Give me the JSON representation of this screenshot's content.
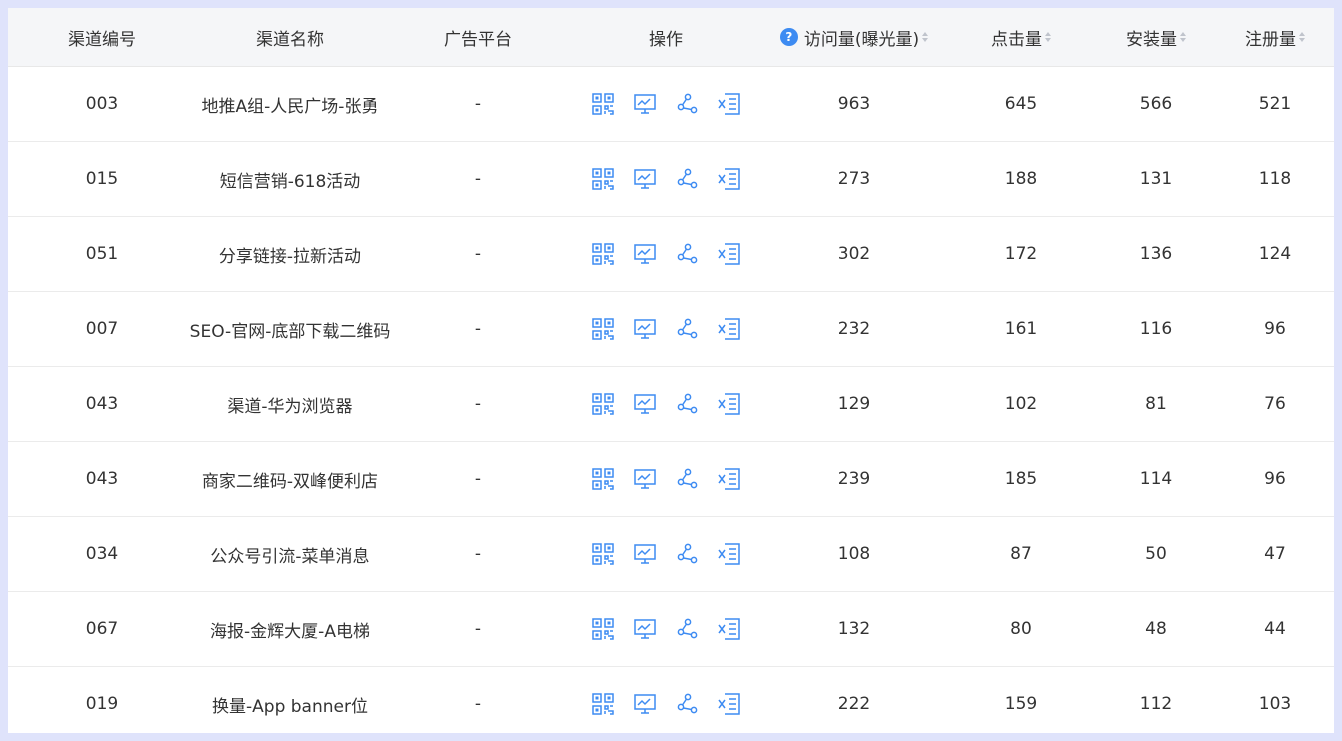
{
  "table": {
    "headers": {
      "id": "渠道编号",
      "name": "渠道名称",
      "platform": "广告平台",
      "ops": "操作",
      "visits": "访问量(曝光量)",
      "clicks": "点击量",
      "installs": "安装量",
      "registrations": "注册量"
    },
    "operations_icons": [
      "qrcode-icon",
      "chart-icon",
      "share-icon",
      "excel-icon"
    ],
    "rows": [
      {
        "id": "003",
        "name": "地推A组-人民广场-张勇",
        "platform": "-",
        "visits": "963",
        "clicks": "645",
        "installs": "566",
        "registrations": "521"
      },
      {
        "id": "015",
        "name": "短信营销-618活动",
        "platform": "-",
        "visits": "273",
        "clicks": "188",
        "installs": "131",
        "registrations": "118"
      },
      {
        "id": "051",
        "name": "分享链接-拉新活动",
        "platform": "-",
        "visits": "302",
        "clicks": "172",
        "installs": "136",
        "registrations": "124"
      },
      {
        "id": "007",
        "name": "SEO-官网-底部下载二维码",
        "platform": "-",
        "visits": "232",
        "clicks": "161",
        "installs": "116",
        "registrations": "96"
      },
      {
        "id": "043",
        "name": "渠道-华为浏览器",
        "platform": "-",
        "visits": "129",
        "clicks": "102",
        "installs": "81",
        "registrations": "76"
      },
      {
        "id": "043",
        "name": "商家二维码-双峰便利店",
        "platform": "-",
        "visits": "239",
        "clicks": "185",
        "installs": "114",
        "registrations": "96"
      },
      {
        "id": "034",
        "name": "公众号引流-菜单消息",
        "platform": "-",
        "visits": "108",
        "clicks": "87",
        "installs": "50",
        "registrations": "47"
      },
      {
        "id": "067",
        "name": "海报-金辉大厦-A电梯",
        "platform": "-",
        "visits": "132",
        "clicks": "80",
        "installs": "48",
        "registrations": "44"
      },
      {
        "id": "019",
        "name": "换量-App banner位",
        "platform": "-",
        "visits": "222",
        "clicks": "159",
        "installs": "112",
        "registrations": "103"
      }
    ]
  },
  "colors": {
    "accent": "#3d8bf2",
    "header_bg": "#f5f6f8",
    "page_bg": "#dfe3fb"
  }
}
